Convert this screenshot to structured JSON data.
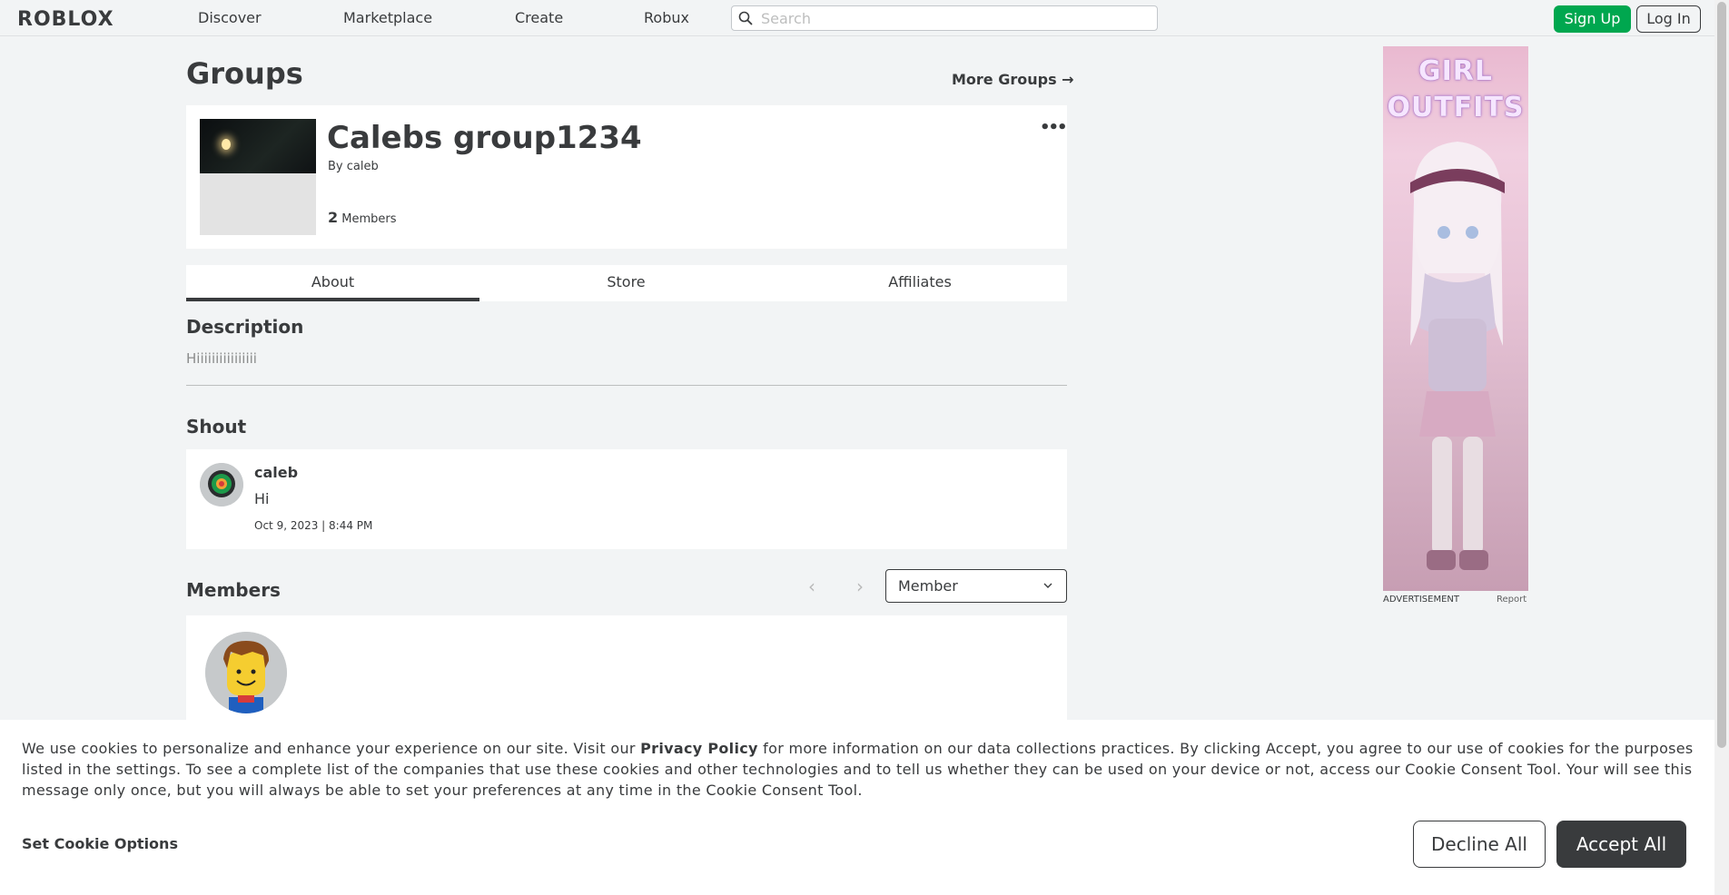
{
  "nav": {
    "logo": "ROBLOX",
    "links": [
      "Discover",
      "Marketplace",
      "Create",
      "Robux"
    ],
    "search_placeholder": "Search",
    "signup": "Sign Up",
    "login": "Log In"
  },
  "page": {
    "title": "Groups",
    "more_groups": "More Groups →"
  },
  "group": {
    "name": "Calebs group1234",
    "by_label": "By",
    "owner": "caleb",
    "member_count": "2",
    "members_label": "Members",
    "menu_icon": "•••"
  },
  "tabs": [
    "About",
    "Store",
    "Affiliates"
  ],
  "about": {
    "description_title": "Description",
    "description_text": "Hiiiiiiiiiiiiiiii",
    "shout_title": "Shout",
    "shout": {
      "user": "caleb",
      "body": "Hi",
      "date": "Oct 9, 2023 | 8:44 PM"
    },
    "members_title": "Members",
    "pager_prev": "‹",
    "pager_next": "›",
    "role_select": "Member"
  },
  "ad": {
    "text": "GIRL OUTFITS",
    "label": "ADVERTISEMENT",
    "report": "Report"
  },
  "cookie": {
    "text_before": "We use cookies to personalize and enhance your experience on our site. Visit our ",
    "link": "Privacy Policy",
    "text_after": " for more information on our data collections practices. By clicking Accept, you agree to our use of cookies for the purposes listed in the settings. To see a complete list of the companies that use these cookies and other technologies and to tell us whether they can be used on your device or not, access our Cookie Consent Tool. Your will see this message only once, but you will always be able to set your preferences at any time in the Cookie Consent Tool.",
    "set_options": "Set Cookie Options",
    "decline": "Decline All",
    "accept": "Accept All"
  },
  "colors": {
    "background": "#f2f4f5",
    "text": "#393b3d",
    "signup_green": "#00a74f",
    "accept_dark": "#393b3d"
  }
}
